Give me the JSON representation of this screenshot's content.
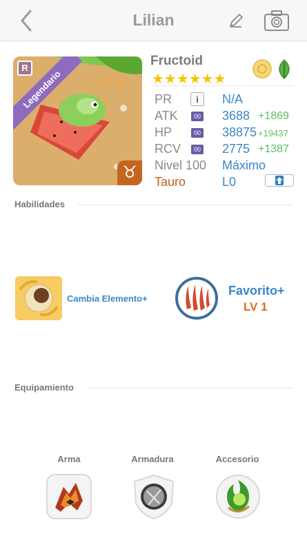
{
  "header": {
    "title": "Lilian",
    "back_icon": "chevron-left-icon",
    "edit_icon": "pencil-icon",
    "camera_icon": "camera-icon"
  },
  "portrait": {
    "rank_letter": "R",
    "rarity_ribbon": "Legendario",
    "zodiac_glyph": "♉"
  },
  "monster": {
    "name": "Fructoid",
    "stars": "★★★★★★",
    "element_icons": [
      "light-element-icon",
      "leaf-element-icon"
    ]
  },
  "stats": {
    "pr": {
      "label": "PR",
      "badge": "i",
      "value": "N/A"
    },
    "atk": {
      "label": "ATK",
      "badge": "00",
      "value": "3688",
      "bonus": "+1869"
    },
    "hp": {
      "label": "HP",
      "badge": "00",
      "value": "38875",
      "bonus": "+19437"
    },
    "rcv": {
      "label": "RCV",
      "badge": "00",
      "value": "2775",
      "bonus": "+1387"
    },
    "level": {
      "label": "Nivel 100",
      "value": "Máximo"
    },
    "zodiac": {
      "label": "Tauro",
      "value": "L0"
    }
  },
  "sections": {
    "abilities": "Habilidades",
    "equipment": "Equipamiento"
  },
  "skill": {
    "name": "Cambia Elemento+"
  },
  "ability": {
    "name": "Favorito+",
    "level": "LV 1"
  },
  "equipment": {
    "weapon": "Arma",
    "armor": "Armadura",
    "accessory": "Accesorio"
  },
  "colors": {
    "accent_blue": "#3a87c8",
    "bonus_green": "#5cbe5c",
    "zodiac_orange": "#c45d1a",
    "ribbon_purple": "#8e6bbf",
    "star_yellow": "#f5c400"
  }
}
